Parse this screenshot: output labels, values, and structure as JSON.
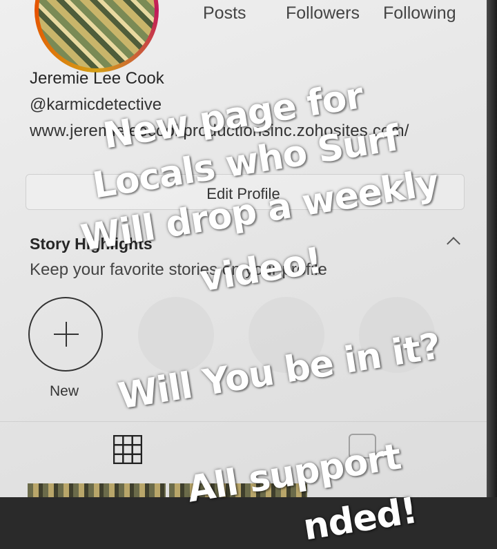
{
  "profile": {
    "stats": [
      "Posts",
      "Followers",
      "Following"
    ],
    "name": "Jeremie Lee Cook",
    "handle": "@karmicdetective",
    "website": "www.jeremieleecookproductionsinc.zohosites.com/",
    "edit_profile_label": "Edit Profile"
  },
  "highlights": {
    "title": "Story Highlights",
    "subtitle": "Keep your favorite stories on your profile",
    "new_label": "New"
  },
  "tabs": {
    "grid_icon": "grid-icon",
    "tagged_icon": "tagged-icon"
  },
  "overlay": {
    "lines": [
      "New page for",
      "Locals who Surf",
      "Will drop a weekly",
      "video!",
      "Will You be in it?",
      "All support"
    ],
    "partial_line": "nded!"
  },
  "colors": {
    "overlay_text": "#ffffff",
    "avatar_ring": "#d4a017"
  }
}
